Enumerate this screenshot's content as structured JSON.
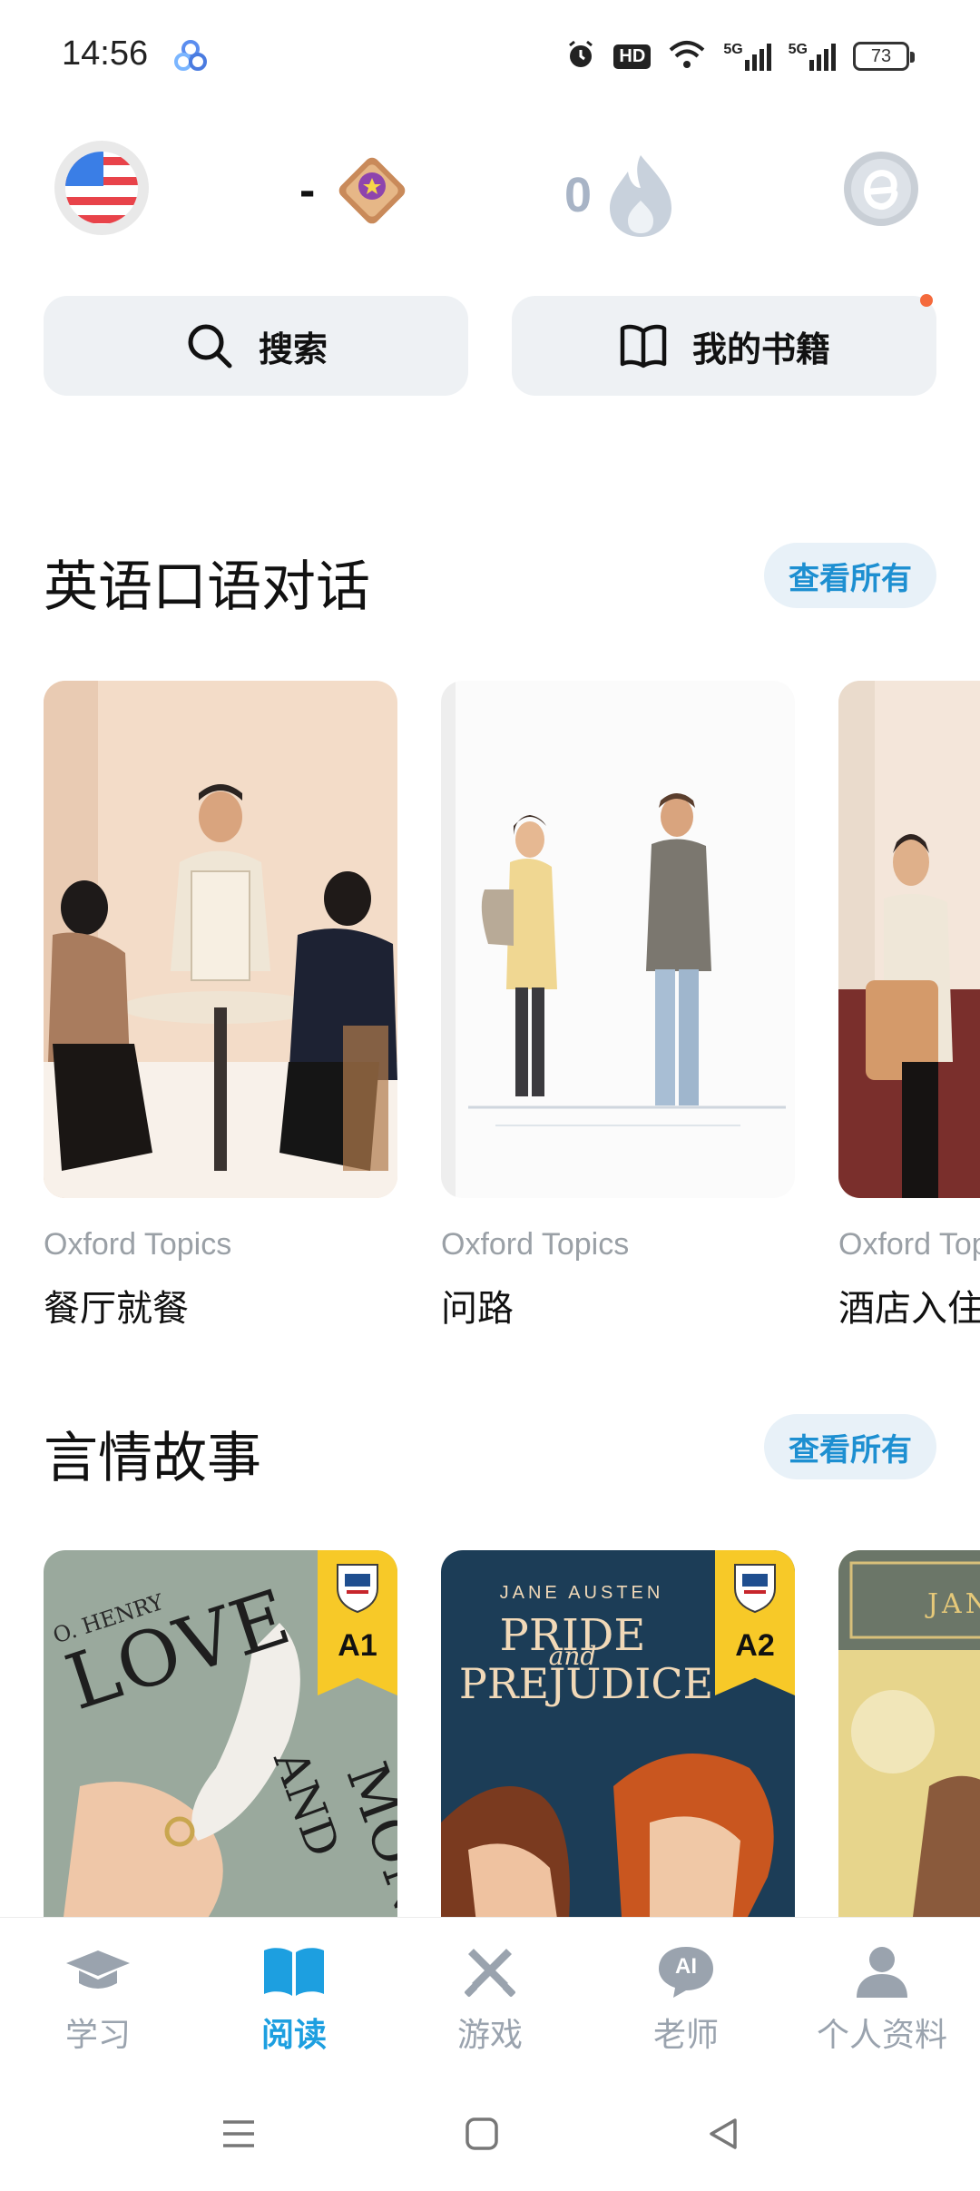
{
  "status_bar": {
    "time": "14:56",
    "hd_label": "HD",
    "signal_1": "5G",
    "signal_2": "5G",
    "battery": "73"
  },
  "header": {
    "league_rank": "-",
    "streak_count": "0"
  },
  "actions": {
    "search_label": "搜索",
    "my_books_label": "我的书籍"
  },
  "sections": [
    {
      "title": "英语口语对话",
      "view_all": "查看所有",
      "cards": [
        {
          "subtitle": "Oxford Topics",
          "title": "餐厅就餐"
        },
        {
          "subtitle": "Oxford Topics",
          "title": "问路"
        },
        {
          "subtitle": "Oxford Topics",
          "title": "酒店入住"
        }
      ]
    },
    {
      "title": "言情故事",
      "view_all": "查看所有",
      "books": [
        {
          "author": "O. HENRY",
          "title_line_1": "LOVE",
          "title_line_2": "AND",
          "title_line_3": "MONEY",
          "level": "A1"
        },
        {
          "author": "JANE AUSTEN",
          "title_line_1": "PRIDE",
          "title_line_2": "and",
          "title_line_3": "PREJUDICE",
          "level": "A2"
        },
        {
          "author": "JANE"
        }
      ]
    }
  ],
  "bottom_nav": [
    {
      "label": "学习",
      "icon": "graduation-cap-icon"
    },
    {
      "label": "阅读",
      "icon": "open-book-icon",
      "active": true
    },
    {
      "label": "游戏",
      "icon": "crossed-swords-icon"
    },
    {
      "label": "老师",
      "icon": "ai-chat-icon",
      "badge": "AI"
    },
    {
      "label": "个人资料",
      "icon": "person-icon"
    }
  ],
  "colors": {
    "accent": "#1d9fe0",
    "inactive": "#9aa3ae",
    "button_bg": "#eef1f4"
  }
}
